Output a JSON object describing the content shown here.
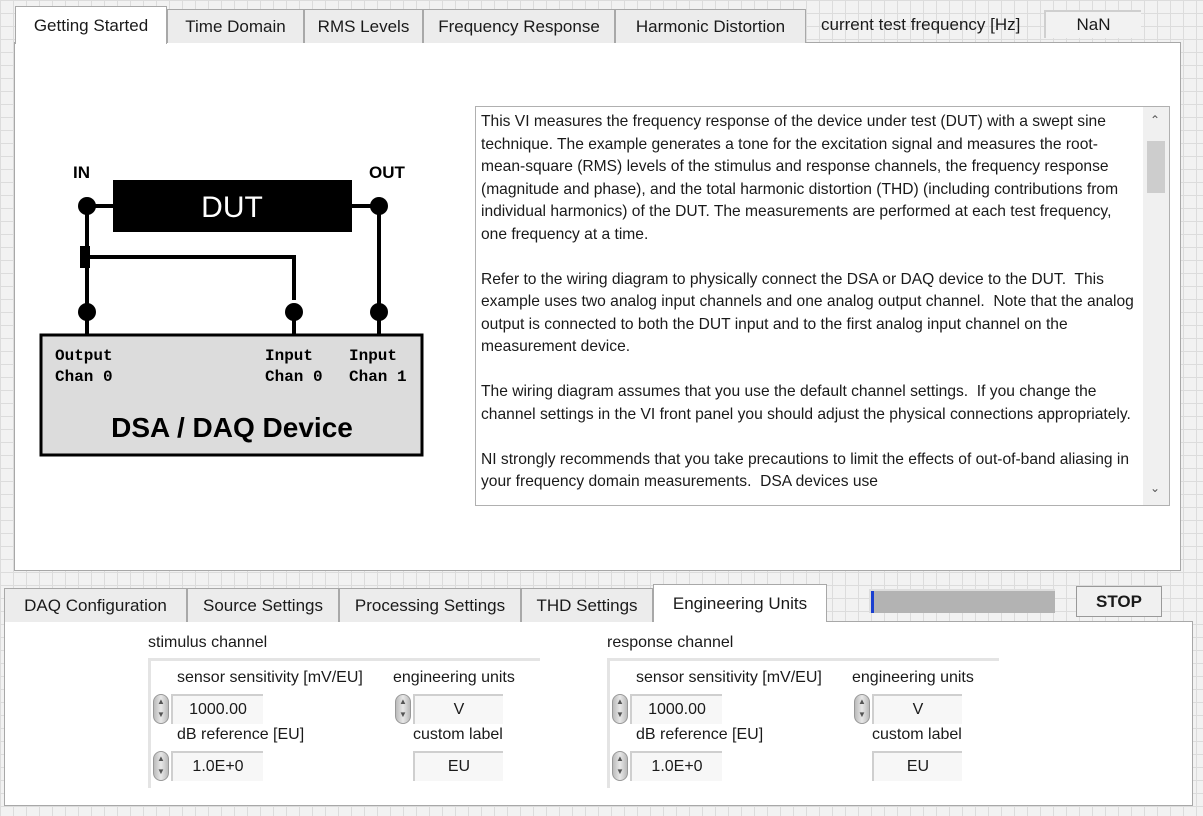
{
  "top_tabs": [
    {
      "label": "Getting Started",
      "active": true
    },
    {
      "label": "Time Domain"
    },
    {
      "label": "RMS Levels"
    },
    {
      "label": "Frequency Response"
    },
    {
      "label": "Harmonic Distortion"
    }
  ],
  "current_freq": {
    "label": "current test frequency [Hz]",
    "value": "NaN"
  },
  "diagram": {
    "in": "IN",
    "out": "OUT",
    "dut": "DUT",
    "output_chan": [
      "Output",
      "Chan 0"
    ],
    "input0": [
      "Input",
      "Chan 0"
    ],
    "input1": [
      "Input",
      "Chan 1"
    ],
    "device": "DSA / DAQ Device"
  },
  "description": "This VI measures the frequency response of the device under test (DUT) with a swept sine technique. The example generates a tone for the excitation signal and measures the root-mean-square (RMS) levels of the stimulus and response channels, the frequency response (magnitude and phase), and the total harmonic distortion (THD) (including contributions from individual harmonics) of the DUT. The measurements are performed at each test frequency, one frequency at a time.\n\nRefer to the wiring diagram to physically connect the DSA or DAQ device to the DUT.  This example uses two analog input channels and one analog output channel.  Note that the analog output is connected to both the DUT input and to the first analog input channel on the measurement device.\n\nThe wiring diagram assumes that you use the default channel settings.  If you change the channel settings in the VI front panel you should adjust the physical connections appropriately.\n\nNI strongly recommends that you take precautions to limit the effects of out-of-band aliasing in your frequency domain measurements.  DSA devices use",
  "bottom_tabs": [
    {
      "label": "DAQ Configuration"
    },
    {
      "label": "Source Settings"
    },
    {
      "label": "Processing Settings"
    },
    {
      "label": "THD Settings"
    },
    {
      "label": "Engineering Units",
      "active": true
    }
  ],
  "progress": {
    "value": 0.01,
    "color": "#1a3fd0"
  },
  "stop_label": "STOP",
  "stimulus": {
    "title": "stimulus channel",
    "sens_label": "sensor sensitivity [mV/EU]",
    "sens": "1000.00",
    "units_label": "engineering units",
    "units": "V",
    "dbref_label": "dB reference [EU]",
    "dbref": "1.0E+0",
    "custom_label": "custom label",
    "custom": "EU"
  },
  "response": {
    "title": "response channel",
    "sens_label": "sensor sensitivity [mV/EU]",
    "sens": "1000.00",
    "units_label": "engineering units",
    "units": "V",
    "dbref_label": "dB reference [EU]",
    "dbref": "1.0E+0",
    "custom_label": "custom label",
    "custom": "EU"
  }
}
